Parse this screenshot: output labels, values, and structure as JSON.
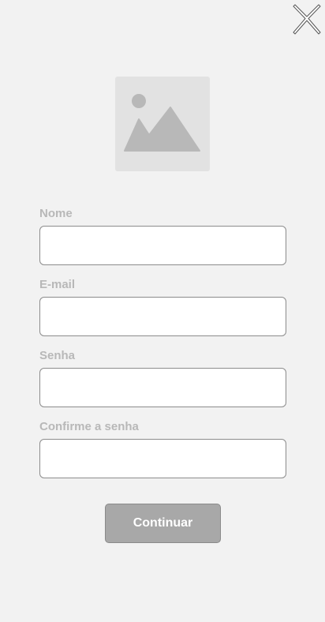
{
  "header": {
    "close_icon": "close-icon"
  },
  "logo": {
    "icon": "image-placeholder-icon"
  },
  "form": {
    "fields": [
      {
        "label": "Nome",
        "value": ""
      },
      {
        "label": "E-mail",
        "value": ""
      },
      {
        "label": "Senha",
        "value": ""
      },
      {
        "label": "Confirme a senha",
        "value": ""
      }
    ],
    "submit_label": "Continuar"
  },
  "colors": {
    "background": "#f2f2f2",
    "label": "#b8b8b8",
    "button": "#a8a8a8",
    "placeholder_image": "#e2e2e2"
  }
}
